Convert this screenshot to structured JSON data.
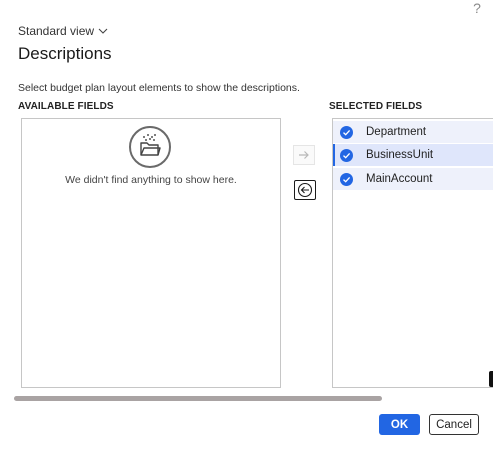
{
  "header": {
    "help_glyph": "?",
    "view_selector_label": "Standard view",
    "title": "Descriptions"
  },
  "instructions": "Select budget plan layout elements to show the descriptions.",
  "available_fields": {
    "label": "AVAILABLE FIELDS",
    "empty_message": "We didn't find anything to show here.",
    "empty_icon": "folder-icon"
  },
  "selected_fields": {
    "label": "SELECTED FIELDS",
    "items": [
      {
        "label": "Department",
        "checked": true
      },
      {
        "label": "BusinessUnit",
        "checked": true,
        "active": true
      },
      {
        "label": "MainAccount",
        "checked": true
      }
    ]
  },
  "transfer": {
    "move_right_icon": "arrow-right-icon",
    "move_left_icon": "arrow-left-icon"
  },
  "actions": {
    "ok_label": "OK",
    "cancel_label": "Cancel"
  },
  "colors": {
    "accent": "#2266e3",
    "row_bg": "#eef1fb",
    "row_active_bg": "#dfe6fb",
    "scrollbar": "#a9a3a3"
  }
}
